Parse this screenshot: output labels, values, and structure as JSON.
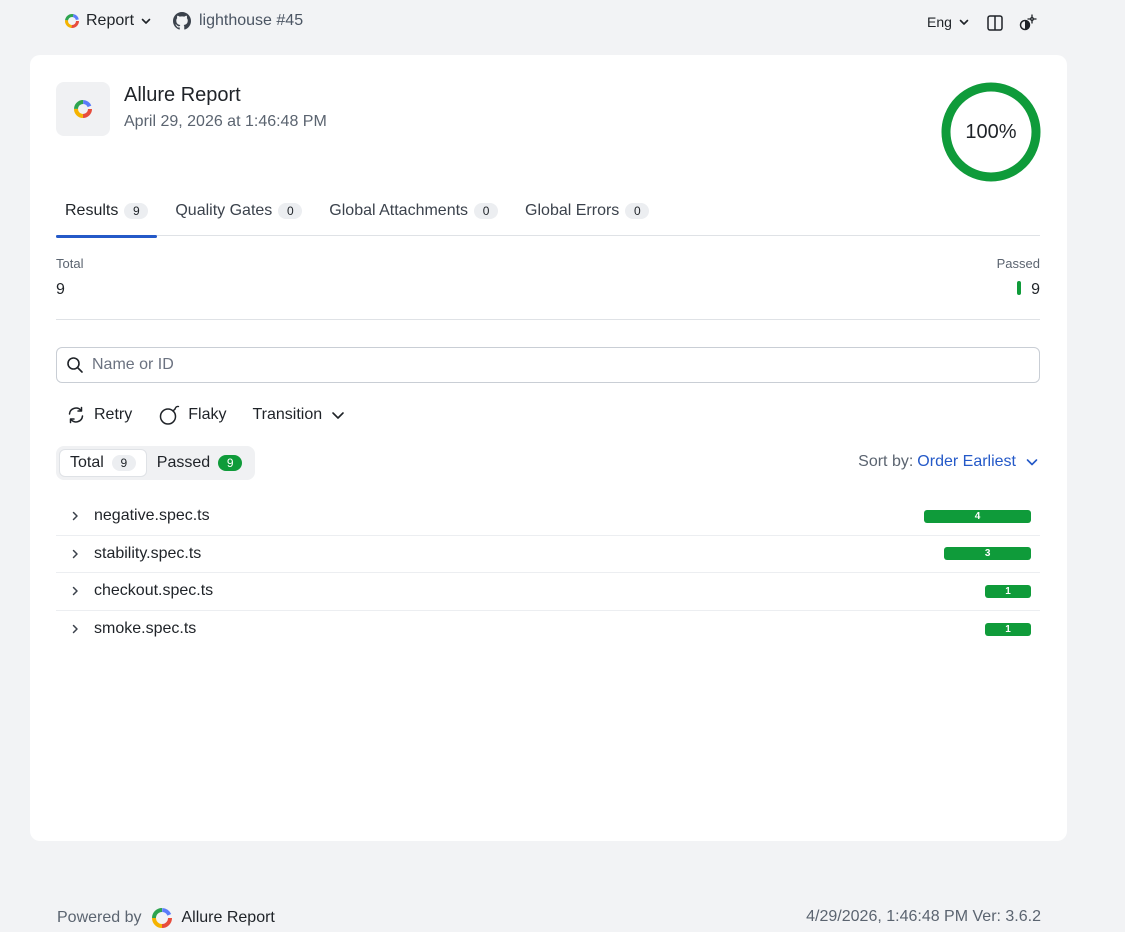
{
  "topbar": {
    "report_label": "Report",
    "repo_label": "lighthouse #45",
    "language": "Eng"
  },
  "header": {
    "title": "Allure Report",
    "date": "April 29, 2026 at 1:46:48 PM",
    "success_rate": "100%",
    "success_fraction": 1.0
  },
  "tabs": [
    {
      "label": "Results",
      "count": "9"
    },
    {
      "label": "Quality Gates",
      "count": "0"
    },
    {
      "label": "Global Attachments",
      "count": "0"
    },
    {
      "label": "Global Errors",
      "count": "0"
    }
  ],
  "stats": {
    "total_label": "Total",
    "total_value": "9",
    "passed_label": "Passed",
    "passed_value": "9"
  },
  "search": {
    "placeholder": "Name or ID"
  },
  "filters": {
    "retry": "Retry",
    "flaky": "Flaky",
    "transition": "Transition"
  },
  "status_filter": {
    "total_label": "Total",
    "total_count": "9",
    "passed_label": "Passed",
    "passed_count": "9"
  },
  "sort": {
    "label": "Sort by:",
    "value": "Order Earliest"
  },
  "tree": [
    {
      "name": "negative.spec.ts",
      "passed": "4",
      "passed_n": 4
    },
    {
      "name": "stability.spec.ts",
      "passed": "3",
      "passed_n": 3
    },
    {
      "name": "checkout.spec.ts",
      "passed": "1",
      "passed_n": 1
    },
    {
      "name": "smoke.spec.ts",
      "passed": "1",
      "passed_n": 1
    }
  ],
  "footer": {
    "powered_by": "Powered by",
    "brand": "Allure Report",
    "meta": "4/29/2026, 1:46:48 PM Ver: 3.6.2"
  },
  "colors": {
    "passed": "#0f9b3a",
    "accent": "#2459c8"
  }
}
